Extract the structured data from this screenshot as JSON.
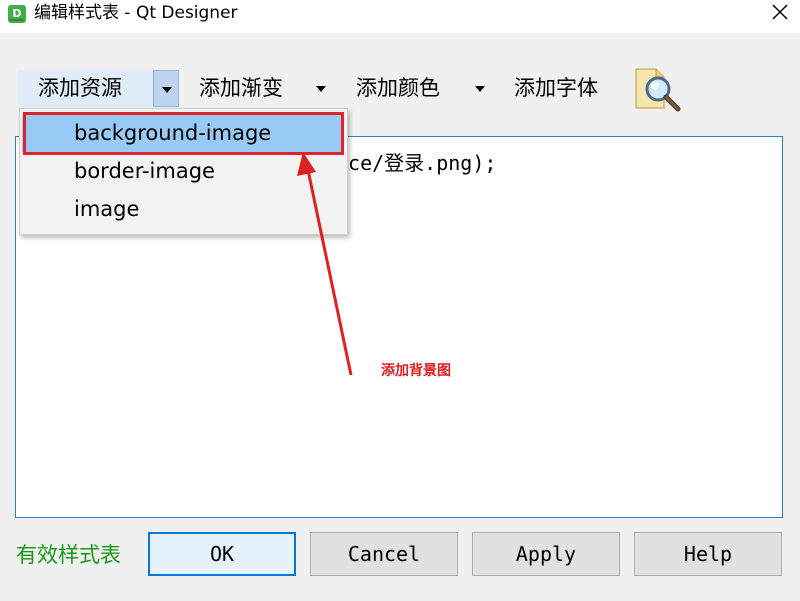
{
  "window": {
    "app_icon_letter": "D",
    "title": "编辑样式表 - Qt Designer",
    "close": "close"
  },
  "toolbar": {
    "add_resource": "添加资源",
    "add_gradient": "添加渐变",
    "add_color": "添加颜色",
    "add_font": "添加字体",
    "font_icon": "magnifier-document-icon"
  },
  "editor": {
    "visible_text": "rce/登录.png);"
  },
  "menu": {
    "items": [
      {
        "label": "background-image",
        "selected": true
      },
      {
        "label": "border-image",
        "selected": false
      },
      {
        "label": "image",
        "selected": false
      }
    ]
  },
  "annotation": {
    "text": "添加背景图",
    "color": "#e02020"
  },
  "footer": {
    "status": "有效样式表",
    "status_color": "#179a1b",
    "ok": "OK",
    "cancel": "Cancel",
    "apply": "Apply",
    "help": "Help"
  }
}
